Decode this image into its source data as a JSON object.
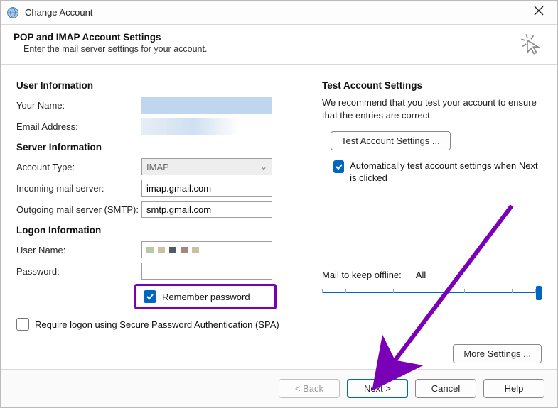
{
  "window": {
    "title": "Change Account"
  },
  "header": {
    "title": "POP and IMAP Account Settings",
    "subtitle": "Enter the mail server settings for your account."
  },
  "left": {
    "user_head": "User Information",
    "name_label": "Your Name:",
    "email_label": "Email Address:",
    "server_head": "Server Information",
    "accttype_label": "Account Type:",
    "accttype_value": "IMAP",
    "incoming_label": "Incoming mail server:",
    "incoming_value": "imap.gmail.com",
    "outgoing_label": "Outgoing mail server (SMTP):",
    "outgoing_value": "smtp.gmail.com",
    "logon_head": "Logon Information",
    "username_label": "User Name:",
    "password_label": "Password:",
    "remember_label": "Remember password",
    "spa_label": "Require logon using Secure Password Authentication (SPA)"
  },
  "right": {
    "test_head": "Test Account Settings",
    "test_desc": "We recommend that you test your account to ensure that the entries are correct.",
    "test_btn": "Test Account Settings ...",
    "auto_test_label": "Automatically test account settings when Next is clicked",
    "offline_label": "Mail to keep offline:",
    "offline_value": "All",
    "more_settings": "More Settings ..."
  },
  "footer": {
    "back": "< Back",
    "next": "Next >",
    "cancel": "Cancel",
    "help": "Help"
  }
}
